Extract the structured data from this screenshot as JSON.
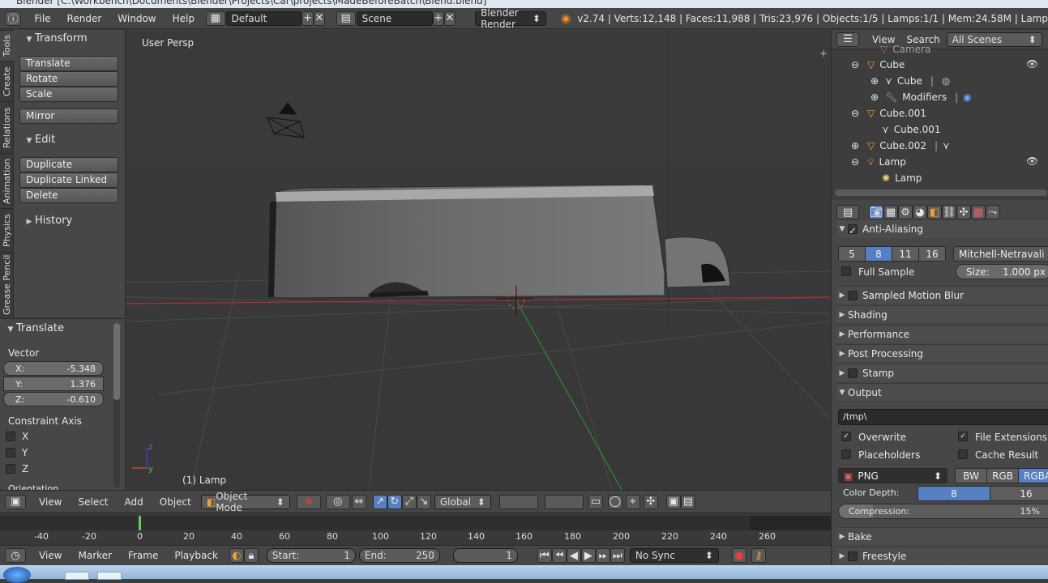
{
  "titlebar": {
    "text": "Blender [C:\\Workbench\\Documents\\Blender\\Projects\\Car\\projects\\MadeBeforeBatch\\Blend.blend]"
  },
  "menubar": {
    "items": [
      "File",
      "Render",
      "Window",
      "Help"
    ],
    "layout": "Default",
    "scene": "Scene",
    "engine": "Blender Render",
    "stats": "v2.74 | Verts:12,148 | Faces:11,988 | Tris:23,976 | Objects:1/5 | Lamps:1/1 | Mem:24.58M | Lamp"
  },
  "tabs": [
    "Tools",
    "Create",
    "Relations",
    "Animation",
    "Physics",
    "Grease Pencil"
  ],
  "toolshelf": {
    "transform": {
      "title": "Transform",
      "buttons": [
        "Translate",
        "Rotate",
        "Scale"
      ],
      "mirror": "Mirror"
    },
    "edit": {
      "title": "Edit",
      "buttons": [
        "Duplicate",
        "Duplicate Linked",
        "Delete"
      ]
    },
    "history": {
      "title": "History"
    }
  },
  "redo": {
    "title": "Translate",
    "vector_label": "Vector",
    "x_label": "X:",
    "x": "-5.348",
    "y_label": "Y:",
    "y": "1.376",
    "z_label": "Z:",
    "z": "-0.610",
    "constraint_label": "Constraint Axis",
    "axes": [
      "X",
      "Y",
      "Z"
    ],
    "orientation_label": "Orientation"
  },
  "viewport": {
    "view_name": "User Persp",
    "object_label": "(1) Lamp"
  },
  "viewheader": {
    "menus": [
      "View",
      "Select",
      "Add",
      "Object"
    ],
    "mode": "Object Mode",
    "orientation": "Global"
  },
  "timeline": {
    "ticks": [
      "-40",
      "-20",
      "0",
      "20",
      "40",
      "60",
      "80",
      "100",
      "120",
      "140",
      "160",
      "180",
      "200",
      "220",
      "240",
      "260"
    ],
    "menus": [
      "View",
      "Marker",
      "Frame",
      "Playback"
    ],
    "start_label": "Start:",
    "start": "1",
    "end_label": "End:",
    "end": "250",
    "current": "1",
    "sync": "No Sync"
  },
  "outliner": {
    "menus": [
      "View",
      "Search"
    ],
    "filter": "All Scenes",
    "rows": [
      {
        "label": "Camera",
        "indent": 0
      },
      {
        "label": "Cube",
        "indent": 0
      },
      {
        "label": "Cube",
        "indent": 1
      },
      {
        "label": "Modifiers",
        "indent": 1
      },
      {
        "label": "Cube.001",
        "indent": 0
      },
      {
        "label": "Cube.001",
        "indent": 1
      },
      {
        "label": "Cube.002",
        "indent": 0
      },
      {
        "label": "Lamp",
        "indent": 0
      },
      {
        "label": "Lamp",
        "indent": 1
      }
    ]
  },
  "properties": {
    "anti_aliasing": "Anti-Aliasing",
    "aa_samples": [
      "5",
      "8",
      "11",
      "16"
    ],
    "aa_filter": "Mitchell-Netravali",
    "full_sample": "Full Sample",
    "size_label": "Size:",
    "size": "1.000 px",
    "panels": [
      "Sampled Motion Blur",
      "Shading",
      "Performance",
      "Post Processing",
      "Stamp"
    ],
    "output": "Output",
    "path": "/tmp\\",
    "overwrite": "Overwrite",
    "file_ext": "File Extensions",
    "placeholders": "Placeholders",
    "cache": "Cache Result",
    "format": "PNG",
    "color_modes": [
      "BW",
      "RGB",
      "RGBA"
    ],
    "color_depth_label": "Color Depth:",
    "depths": [
      "8",
      "16"
    ],
    "compression_label": "Compression:",
    "compression": "15%",
    "bake": "Bake",
    "freestyle": "Freestyle"
  },
  "colors": {
    "accent": "#5680c2",
    "x_axis": "#d03030",
    "y_axis": "#30a030"
  }
}
